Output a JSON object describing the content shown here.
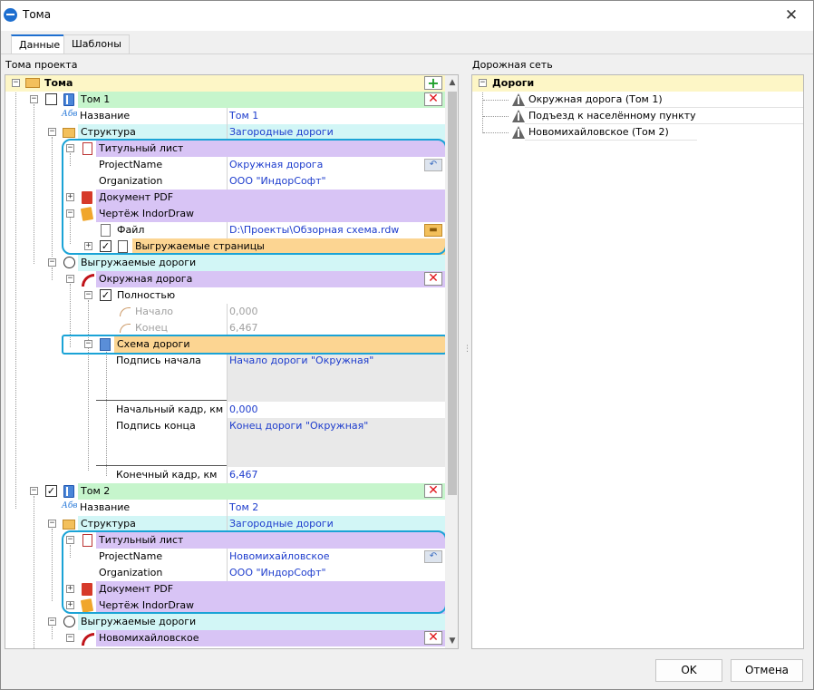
{
  "window": {
    "title": "Тома",
    "close_glyph": "✕"
  },
  "tabs": [
    {
      "label": "Данные",
      "active": true
    },
    {
      "label": "Шаблоны",
      "active": false
    }
  ],
  "left": {
    "section_label": "Тома проекта",
    "root": {
      "label": "Тома"
    },
    "volume1": {
      "label": "Том 1",
      "name_label": "Название",
      "name_value": "Том 1",
      "structure_label": "Структура",
      "structure_value": "Загородные дороги",
      "title_sheet": "Титульный лист",
      "project_name_label": "ProjectName",
      "project_name_value": "Окружная дорога",
      "organization_label": "Organization",
      "organization_value": "ООО \"ИндорСофт\"",
      "pdf_label": "Документ PDF",
      "drawing_label": "Чертёж IndorDraw",
      "file_label": "Файл",
      "file_value": "D:\\Проекты\\Обзорная схема.rdw",
      "pages_label": "Выгружаемые страницы",
      "exported_roads": "Выгружаемые дороги",
      "road": "Окружная дорога",
      "full_label": "Полностью",
      "start_label": "Начало",
      "start_value": "0,000",
      "end_label": "Конец",
      "end_value": "6,467",
      "scheme_label": "Схема дороги",
      "start_caption_label": "Подпись начала",
      "start_caption_value": "Начало дороги \"Окружная\"",
      "start_frame_label": "Начальный кадр, км",
      "start_frame_value": "0,000",
      "end_caption_label": "Подпись конца",
      "end_caption_value": "Конец дороги \"Окружная\"",
      "end_frame_label": "Конечный кадр, км",
      "end_frame_value": "6,467"
    },
    "volume2": {
      "label": "Том 2",
      "name_label": "Название",
      "name_value": "Том 2",
      "structure_label": "Структура",
      "structure_value": "Загородные дороги",
      "title_sheet": "Титульный лист",
      "project_name_label": "ProjectName",
      "project_name_value": "Новомихайловское",
      "organization_label": "Organization",
      "organization_value": "ООО \"ИндорСофт\"",
      "pdf_label": "Документ PDF",
      "drawing_label": "Чертёж IndorDraw",
      "exported_roads": "Выгружаемые дороги",
      "road": "Новомихайловское"
    }
  },
  "right": {
    "section_label": "Дорожная сеть",
    "root": "Дороги",
    "items": [
      "Окружная дорога (Том 1)",
      "Подъезд к населённому пункту",
      "Новомихайловское (Том 2)"
    ]
  },
  "icons": {
    "text_icon": "Абв",
    "plus": "+",
    "minus": "−",
    "check": "✓",
    "delete": "✕",
    "add": "+",
    "undo": "↶",
    "folder": "▬",
    "scroll_up": "▲",
    "scroll_down": "▼",
    "grip": "⋮"
  },
  "buttons": {
    "ok": "OK",
    "cancel": "Отмена"
  }
}
